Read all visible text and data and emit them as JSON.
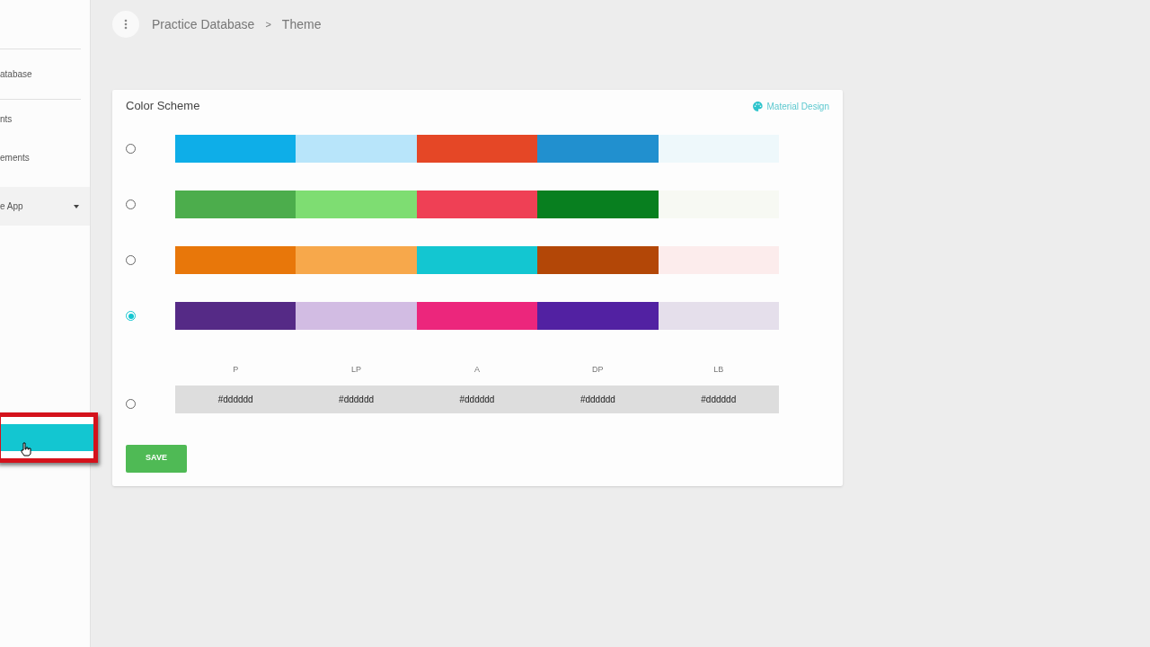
{
  "sidebar": {
    "items": [
      {
        "label": "atabase",
        "kind": "text",
        "selected": false
      },
      {
        "label": "nts",
        "kind": "text",
        "selected": false
      },
      {
        "label": "ements",
        "kind": "text",
        "selected": false
      },
      {
        "label": "e App",
        "kind": "dropdown",
        "selected": false
      },
      {
        "kind": "highlight",
        "selected": true
      }
    ]
  },
  "breadcrumb": [
    "Practice Database",
    ">",
    "Theme"
  ],
  "card": {
    "title": "Color Scheme",
    "link": "Material Design",
    "schemes": [
      {
        "selected": false,
        "swatches": [
          {
            "color": "#0eaee8"
          },
          {
            "color": "#b8e5fa"
          },
          {
            "color": "#e54726"
          },
          {
            "color": "#2190cf"
          },
          {
            "color": "#eef8fb"
          }
        ]
      },
      {
        "selected": false,
        "swatches": [
          {
            "color": "#4cad4c"
          },
          {
            "color": "#7edd72"
          },
          {
            "color": "#ef4055"
          },
          {
            "color": "#087f1f"
          },
          {
            "color": "#f7f9f3"
          }
        ]
      },
      {
        "selected": false,
        "swatches": [
          {
            "color": "#e8770a"
          },
          {
            "color": "#f7a84b"
          },
          {
            "color": "#13c6d1"
          },
          {
            "color": "#b34707"
          },
          {
            "color": "#fcecec"
          }
        ]
      },
      {
        "selected": true,
        "swatches": [
          {
            "color": "#552a86"
          },
          {
            "color": "#d2bce3"
          },
          {
            "color": "#ec267c"
          },
          {
            "color": "#5221a2"
          },
          {
            "color": "#e5dfeb"
          }
        ]
      }
    ],
    "custom": {
      "selected": false,
      "columns": [
        "P",
        "LP",
        "A",
        "DP",
        "LB"
      ],
      "values": [
        "#dddddd",
        "#dddddd",
        "#dddddd",
        "#dddddd",
        "#dddddd"
      ]
    },
    "save_button": "SAVE"
  }
}
